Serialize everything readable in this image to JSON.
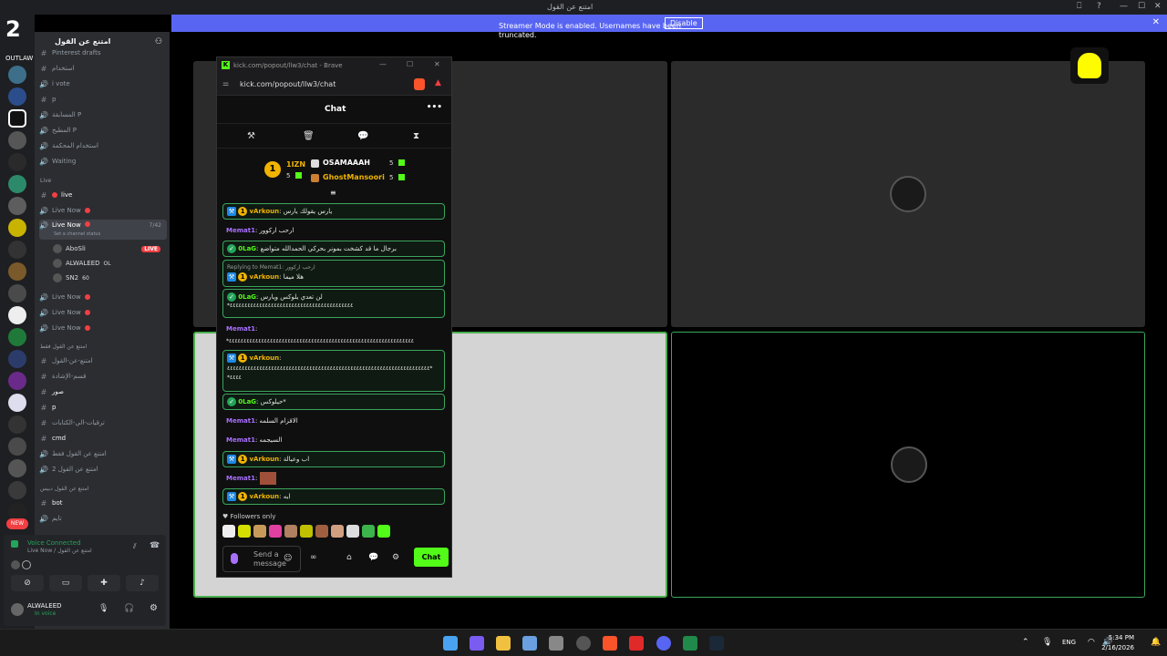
{
  "window": {
    "title": "امتنع عن القول",
    "controls": [
      "⎕",
      "?",
      "—",
      "☐",
      "✕"
    ]
  },
  "banner": {
    "message": "Streamer Mode is enabled. Usernames have been truncated.",
    "disable_label": "Disable",
    "close": "✕"
  },
  "server": {
    "name": "امتنع عن القول",
    "outlaw_label": "OUTLAW"
  },
  "channels": [
    {
      "icon": "#",
      "label": "Pinterest drafts"
    },
    {
      "icon": "#",
      "label": "استخدام"
    },
    {
      "icon": "🔊",
      "label": "i vote"
    },
    {
      "icon": "#",
      "label": "p"
    },
    {
      "icon": "🔊",
      "label": "المسابقة P"
    },
    {
      "icon": "🔊",
      "label": "المطبخ P"
    },
    {
      "icon": "🔊",
      "label": "استخدام المحكمة"
    },
    {
      "icon": "🔊",
      "label": "Waiting"
    }
  ],
  "live_category": "Live",
  "live_channels": [
    {
      "icon": "#",
      "label": "live"
    },
    {
      "icon": "🔊",
      "label": "Live Now"
    },
    {
      "icon": "🔊",
      "label": "Live Now",
      "count": "7/42",
      "status": "Set a channel status"
    }
  ],
  "voice_users": [
    {
      "name": "AboSli",
      "badge": "LIVE"
    },
    {
      "name": "ALWALEED",
      "extra": "OL"
    },
    {
      "name": "SN2",
      "extra": "60"
    }
  ],
  "live_more": [
    "Live Now",
    "Live Now",
    "Live Now"
  ],
  "category2": "امتنع عن القول فقط",
  "channels2": [
    {
      "icon": "#",
      "label": "امتنع-عن-القول"
    },
    {
      "icon": "#",
      "label": "قسم-الإشادة"
    },
    {
      "icon": "#",
      "label": "صور"
    },
    {
      "icon": "#",
      "label": "p"
    },
    {
      "icon": "#",
      "label": "ترقيات-الي-الكتابات"
    },
    {
      "icon": "#",
      "label": "cmd"
    },
    {
      "icon": "🔊",
      "label": "امتنع عن القول فقط"
    },
    {
      "icon": "🔊",
      "label": "امتنع عن القول 2"
    }
  ],
  "category3": "امتنع عن القول دبيس",
  "channels3": [
    {
      "icon": "#",
      "label": "bot"
    },
    {
      "icon": "🔊",
      "label": "تايم"
    }
  ],
  "voice_panel": {
    "status": "Voice Connected",
    "channel": "Live Now / امتنع عن القول"
  },
  "me": {
    "name": "ALWALEED",
    "status": "In voice"
  },
  "popup": {
    "title": "kick.com/popout/llw3/chat - Brave",
    "url": "kick.com/popout/llw3/chat",
    "chat_title": "Chat",
    "menu": "•••"
  },
  "leaderboard": {
    "top": {
      "rank": "1",
      "name": "1IZN",
      "count": "5"
    },
    "second": {
      "name": "OSAMAAAH",
      "count": "5"
    },
    "third": {
      "name": "GhostMansoori",
      "count": "5"
    }
  },
  "messages": [
    {
      "user": "vArkoun",
      "text": "يارس يقولك يارس",
      "style": "v"
    },
    {
      "user": "Memat1",
      "text": "ارحب اركوور",
      "style": "m"
    },
    {
      "user": "0LaG",
      "text": "برجال ما قد كشخت بمونر بحركي الحمدالله متواضع",
      "style": "o"
    },
    {
      "user": "vArkoun",
      "text": "هلا ميما",
      "style": "v",
      "reply": "Replying to Memat1: ارحب اركوور"
    },
    {
      "user": "0LaG",
      "text": "لن تعدي يلوكس ويارس",
      "line2": "*٤٤٤٤٤٤٤٤٤٤٤٤٤٤٤٤٤٤٤٤٤٤٤٤٤٤٤٤٤٤٤٤٤٤٤٤٤٤٤٤٤٤",
      "style": "o"
    },
    {
      "user": "Memat1",
      "text": "",
      "line2": "*٤٤٤٤٤٤٤٤٤٤٤٤٤٤٤٤٤٤٤٤٤٤٤٤٤٤٤٤٤٤٤٤٤٤٤٤٤٤٤٤٤٤٤٤٤٤٤٤٤٤٤٤٤٤٤٤٤٤٤٤٤٤٤",
      "style": "m"
    },
    {
      "user": "vArkoun",
      "text": "",
      "line2": "٤٤٤٤٤٤٤٤٤٤٤٤٤٤٤٤٤٤٤٤٤٤٤٤٤٤٤٤٤٤٤٤٤٤٤٤٤٤٤٤٤٤٤٤٤٤٤٤٤٤٤٤٤٤٤٤٤٤٤٤٤٤٤٤٤٤٤٤٤*",
      "line3": "*٤٤٤٤",
      "style": "v"
    },
    {
      "user": "0LaG",
      "text": "حيلوكس*",
      "style": "o"
    },
    {
      "user": "Memat1",
      "text": "الاقزام السلمه",
      "style": "m"
    },
    {
      "user": "Memat1",
      "text": "السيجمه",
      "style": "m"
    },
    {
      "user": "vArkoun",
      "text": "اب وعيالة",
      "style": "v"
    },
    {
      "user": "Memat1",
      "text": "",
      "style": "m"
    },
    {
      "user": "vArkoun",
      "text": "ايه",
      "style": "v"
    }
  ],
  "followers_only": "Followers only",
  "input": {
    "placeholder": "Send a message"
  },
  "chat_button": "Chat",
  "taskbar": {
    "lang": "ENG",
    "time": "5:34 PM",
    "date": "2/16/2026"
  }
}
